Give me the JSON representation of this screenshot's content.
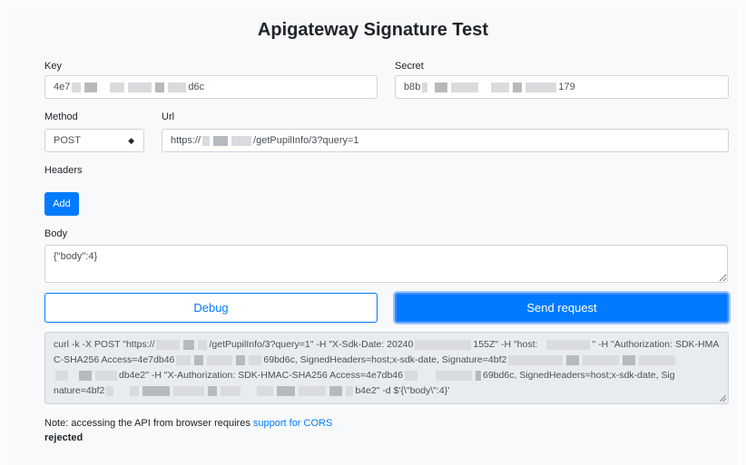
{
  "page": {
    "title": "Apigateway Signature Test"
  },
  "fields": {
    "key": {
      "label": "Key",
      "value_start": "4e7",
      "value_end": "d6c"
    },
    "secret": {
      "label": "Secret",
      "value_start": "b8b",
      "value_end": "179"
    },
    "method": {
      "label": "Method",
      "value": "POST"
    },
    "url": {
      "label": "Url",
      "value_start": "https://",
      "value_end": "/getPupilInfo/3?query=1"
    },
    "headers": {
      "label": "Headers",
      "add_label": "Add"
    },
    "body": {
      "label": "Body",
      "value": "{\"body\":4}"
    }
  },
  "buttons": {
    "debug": "Debug",
    "send": "Send request"
  },
  "curl": {
    "line1_a": "curl -k -X POST \"https://",
    "line1_b": "/getPupilInfo/3?query=1\" -H \"X-Sdk-Date: 20240",
    "line1_c": "155Z\" -H \"host:",
    "line1_d": "\" -H \"Authorization: SDK-HMA",
    "line2_a": "C-SHA256 Access=4e7db46",
    "line2_b": "69bd6c, SignedHeaders=host;x-sdk-date, Signature=4bf2",
    "line3_a": "db4e2\" -H \"X-Authorization: SDK-HMAC-SHA256 Access=4e7db46",
    "line3_b": "69bd6c, SignedHeaders=host;x-sdk-date, Sig",
    "line4_a": "nature=4bf2",
    "line4_b": "b4e2\" -d $'{\\\"body\\\":4}'"
  },
  "note": {
    "text": "Note: accessing the API from browser requires ",
    "link": "support for CORS"
  },
  "status": "rejected",
  "colors": {
    "primary": "#007bff",
    "background": "#f8f9fa",
    "input_border": "#ced4da"
  }
}
